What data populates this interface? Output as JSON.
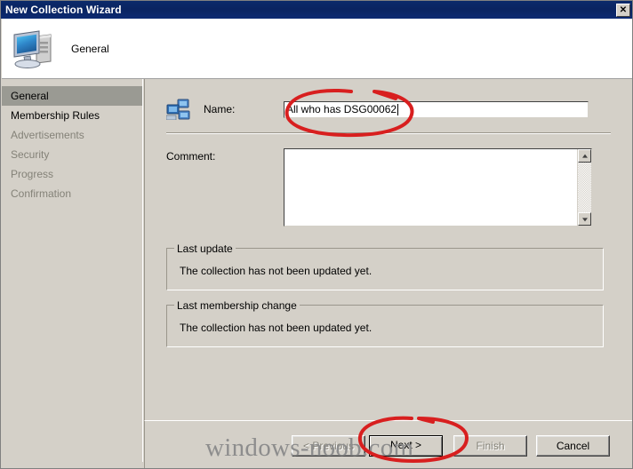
{
  "window": {
    "title": "New Collection Wizard",
    "close_label": "✕"
  },
  "header": {
    "title": "General",
    "icon": "computer-icon"
  },
  "sidebar": {
    "items": [
      {
        "label": "General",
        "state": "selected"
      },
      {
        "label": "Membership Rules",
        "state": "enabled"
      },
      {
        "label": "Advertisements",
        "state": "disabled"
      },
      {
        "label": "Security",
        "state": "disabled"
      },
      {
        "label": "Progress",
        "state": "disabled"
      },
      {
        "label": "Confirmation",
        "state": "disabled"
      }
    ]
  },
  "form": {
    "name_icon": "collection-computers-icon",
    "name_label": "Name:",
    "name_value": "All who has DSG00062",
    "name_placeholder": "",
    "comment_label": "Comment:",
    "comment_value": "",
    "comment_placeholder": ""
  },
  "groups": [
    {
      "legend": "Last update",
      "text": "The collection has not been updated yet."
    },
    {
      "legend": "Last membership change",
      "text": "The collection has not been updated yet."
    }
  ],
  "buttons": {
    "previous": "< Previous",
    "next": "Next >",
    "finish": "Finish",
    "cancel": "Cancel"
  },
  "watermark": {
    "text": "windows-noob.com"
  },
  "colors": {
    "titlebar": "#0a2461",
    "face": "#d4d0c8",
    "selected_row": "#9a9a93",
    "disabled_text": "#848278",
    "annotation": "#d81f1f"
  }
}
